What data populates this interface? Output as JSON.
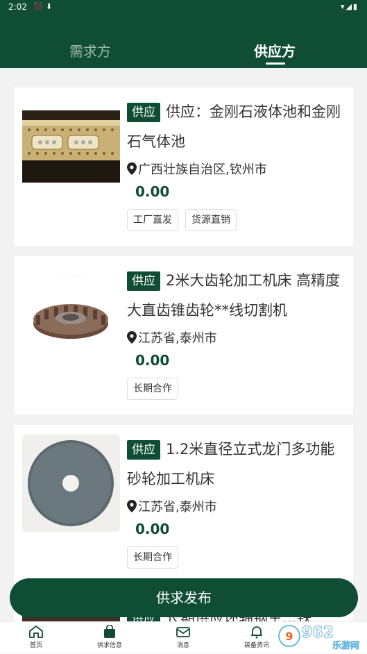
{
  "status_bar": {
    "time": "2:02"
  },
  "tabs": [
    {
      "label": "需求方",
      "active": false
    },
    {
      "label": "供应方",
      "active": true
    }
  ],
  "listings": [
    {
      "tag": "供应",
      "title": "供应：金刚石液体池和金刚石气体池",
      "location": "广西壮族自治区,钦州市",
      "price": "0.00",
      "chips": [
        "工厂直发",
        "货源直销"
      ],
      "image": "diamond-cell-photo"
    },
    {
      "tag": "供应",
      "title": "2米大齿轮加工机床 高精度大直齿锥齿轮**线切割机",
      "location": "江苏省,泰州市",
      "price": "0.00",
      "chips": [
        "长期合作"
      ],
      "image": "bevel-gear-photo"
    },
    {
      "tag": "供应",
      "title": "1.2米直径立式龙门多功能砂轮加工机床",
      "location": "江苏省,泰州市",
      "price": "0.00",
      "chips": [
        "长期合作"
      ],
      "image": "grinding-wheel-photo"
    },
    {
      "tag": "供应",
      "title": "长期供应环轴钢主…铁",
      "partial": true
    }
  ],
  "publish_button": "供求发布",
  "bottom_nav": [
    {
      "label": "首页",
      "icon": "home-icon"
    },
    {
      "label": "供求信息",
      "icon": "bag-icon"
    },
    {
      "label": "消息",
      "icon": "mail-icon"
    },
    {
      "label": "装备资讯",
      "icon": "bell-icon"
    }
  ],
  "watermark": {
    "text": "962",
    "sub_text": "乐游网"
  },
  "colors": {
    "brand_green": "#0f4d34",
    "text": "#333333",
    "background": "#f2f2f2"
  }
}
